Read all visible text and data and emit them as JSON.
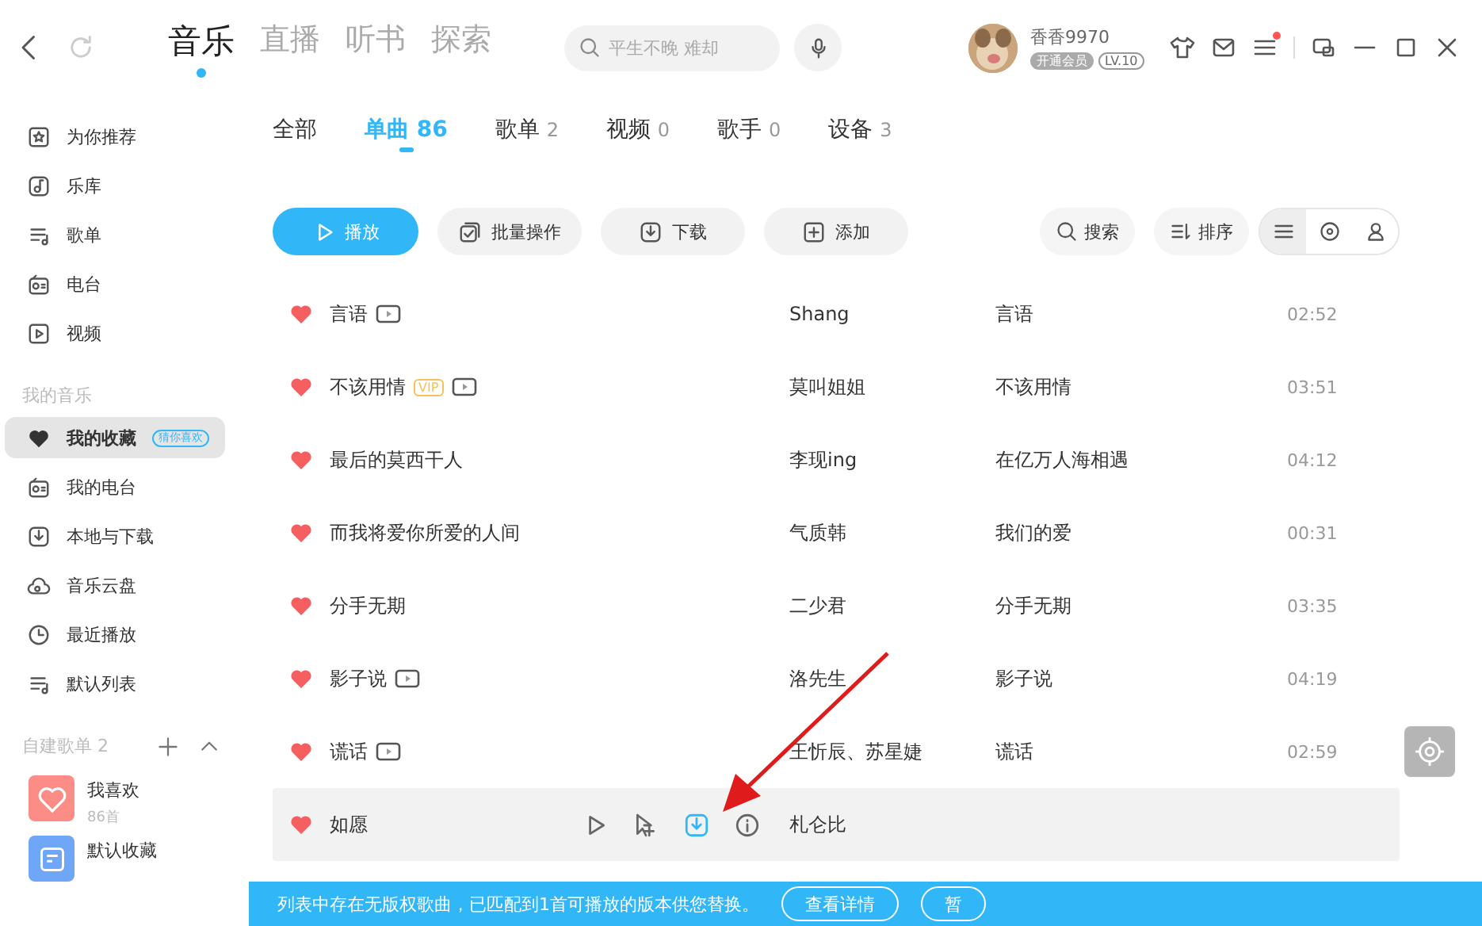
{
  "top_tabs": [
    {
      "label": "音乐",
      "selected": true
    },
    {
      "label": "直播",
      "selected": false
    },
    {
      "label": "听书",
      "selected": false
    },
    {
      "label": "探索",
      "selected": false
    }
  ],
  "search": {
    "placeholder": "平生不晚 难却"
  },
  "user": {
    "name": "香香9970",
    "vip_badge": "开通会员",
    "level": "LV.10",
    "has_notice": true
  },
  "sidebar": {
    "items": [
      {
        "kind": "star",
        "label": "为你推荐",
        "selected": false
      },
      {
        "kind": "note",
        "label": "乐库",
        "selected": false
      },
      {
        "kind": "list",
        "label": "歌单",
        "selected": false
      },
      {
        "kind": "radio",
        "label": "电台",
        "selected": false
      },
      {
        "kind": "play",
        "label": "视频",
        "selected": false
      }
    ],
    "my_music_title": "我的音乐",
    "my_music": [
      {
        "kind": "heart",
        "label": "我的收藏",
        "badge": "猜你喜欢",
        "selected": true
      },
      {
        "kind": "radio",
        "label": "我的电台",
        "selected": false
      },
      {
        "kind": "download",
        "label": "本地与下载",
        "selected": false
      },
      {
        "kind": "cloud",
        "label": "音乐云盘",
        "selected": false
      },
      {
        "kind": "clock",
        "label": "最近播放",
        "selected": false
      },
      {
        "kind": "list",
        "label": "默认列表",
        "selected": false
      }
    ],
    "playlists_title": "自建歌单 2",
    "playlists": [
      {
        "kind": "heart",
        "name": "我喜欢",
        "count": "86首",
        "color": "#fb8d86"
      },
      {
        "kind": "list",
        "name": "默认收藏",
        "color": "#6fa6f8"
      }
    ]
  },
  "filter_tabs": [
    {
      "label": "全部",
      "selected": false
    },
    {
      "label": "单曲",
      "count": "86",
      "selected": true
    },
    {
      "label": "歌单",
      "count": "2",
      "selected": false
    },
    {
      "label": "视频",
      "count": "0",
      "selected": false
    },
    {
      "label": "歌手",
      "count": "0",
      "selected": false
    },
    {
      "label": "设备",
      "count": "3",
      "selected": false
    }
  ],
  "toolbar": [
    {
      "kind": "play",
      "label": "播放"
    },
    {
      "kind": "batch",
      "label": "批量操作"
    },
    {
      "kind": "download",
      "label": "下载"
    },
    {
      "kind": "add",
      "label": "添加"
    }
  ],
  "tools": [
    {
      "kind": "search",
      "label": "搜索"
    },
    {
      "kind": "sort",
      "label": "排序"
    }
  ],
  "view_modes": [
    {
      "kind": "list",
      "selected": true
    },
    {
      "kind": "disc",
      "selected": false
    },
    {
      "kind": "person",
      "selected": false
    }
  ],
  "songs": [
    {
      "title": "言语",
      "vip": false,
      "mv": true,
      "artist": "Shang",
      "album": "言语",
      "duration": "02:52",
      "liked": true,
      "selected": false
    },
    {
      "title": "不该用情",
      "vip": true,
      "vip_label": "VIP",
      "mv": true,
      "artist": "莫叫姐姐",
      "album": "不该用情",
      "duration": "03:51",
      "liked": true,
      "selected": false
    },
    {
      "title": "最后的莫西干人",
      "vip": false,
      "mv": false,
      "artist": "李现ing",
      "album": "在亿万人海相遇",
      "duration": "04:12",
      "liked": true,
      "selected": false
    },
    {
      "title": "而我将爱你所爱的人间",
      "vip": false,
      "mv": false,
      "artist": "气质韩",
      "album": "我们的爱",
      "duration": "00:31",
      "liked": true,
      "selected": false
    },
    {
      "title": "分手无期",
      "vip": false,
      "mv": false,
      "artist": "二少君",
      "album": "分手无期",
      "duration": "03:35",
      "liked": true,
      "selected": false
    },
    {
      "title": "影子说",
      "vip": false,
      "mv": true,
      "artist": "洛先生",
      "album": "影子说",
      "duration": "04:19",
      "liked": true,
      "selected": false
    },
    {
      "title": "谎话",
      "vip": false,
      "mv": true,
      "artist": "王忻辰、苏星婕",
      "album": "谎话",
      "duration": "02:59",
      "liked": true,
      "selected": false
    },
    {
      "title": "如愿",
      "vip": false,
      "mv": false,
      "artist": "札仑比",
      "liked": true,
      "selected": true,
      "actions": [
        {
          "kind": "play",
          "active": false
        },
        {
          "kind": "addto",
          "active": false
        },
        {
          "kind": "download",
          "active": true
        },
        {
          "kind": "more",
          "active": false
        }
      ]
    }
  ],
  "banner": {
    "text": "列表中存在无版权歌曲，已匹配到1首可播放的版本供您替换。",
    "buttons": [
      "查看详情",
      "暂"
    ]
  },
  "annotation": {
    "kind": "arrow"
  }
}
